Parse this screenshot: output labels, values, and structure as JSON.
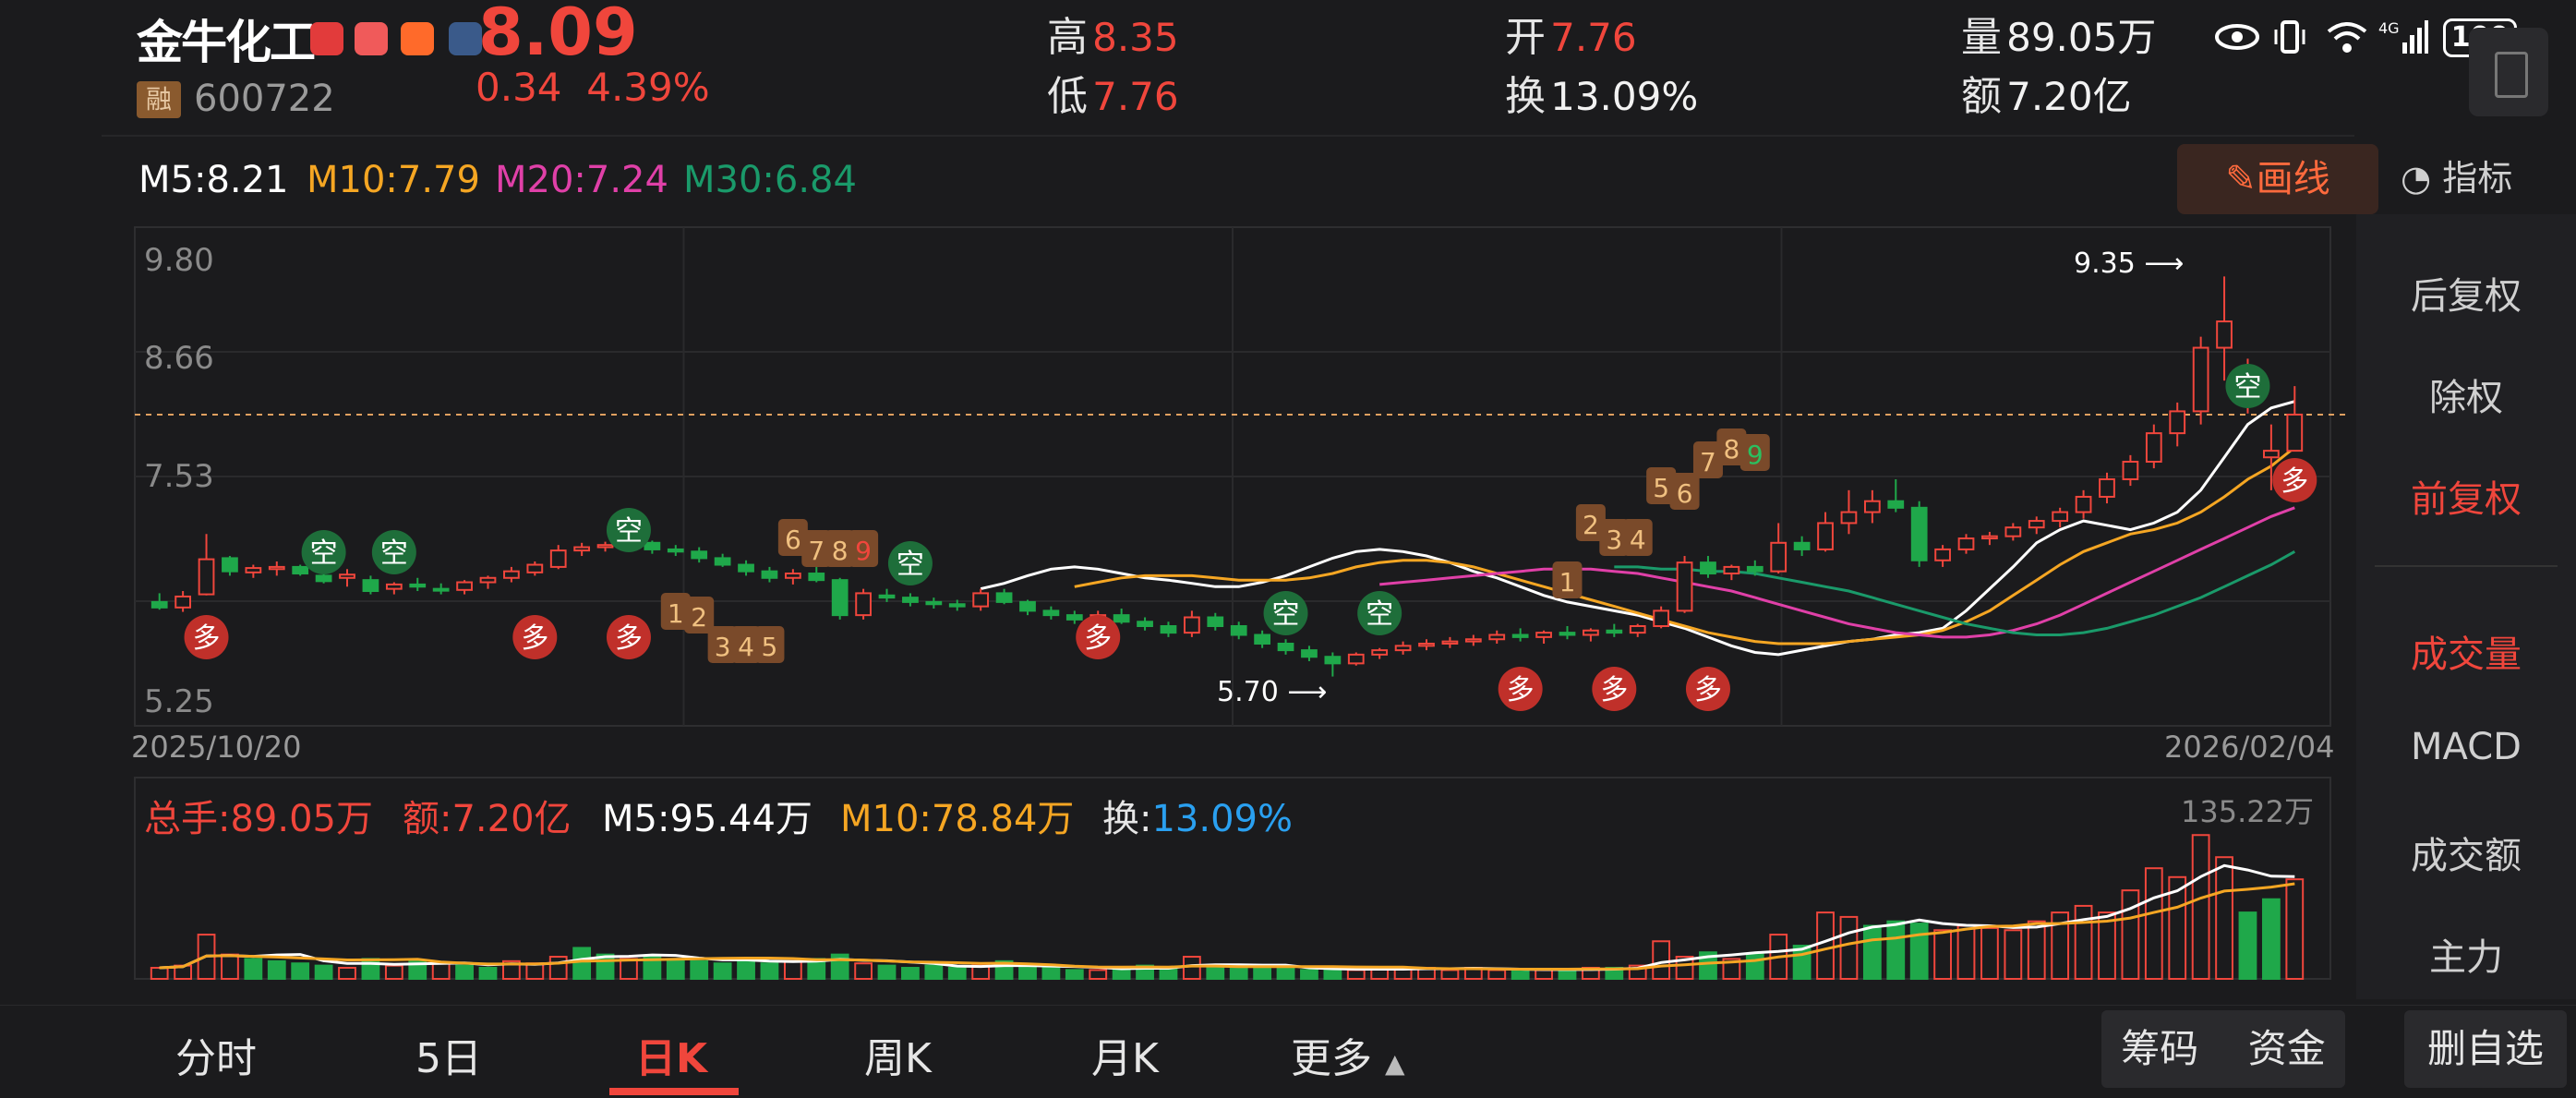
{
  "header": {
    "stock_name": "金牛化工",
    "price": "8.09",
    "change": "0.34",
    "change_pct": "4.39%",
    "margin_badge": "融",
    "code": "600722",
    "high_label": "高",
    "high": "8.35",
    "low_label": "低",
    "low": "7.76",
    "open_label": "开",
    "open": "7.76",
    "turnover_label": "换",
    "turnover": "13.09%",
    "volume_label": "量",
    "volume": "89.05万",
    "amount_label": "额",
    "amount": "7.20亿",
    "battery": "100"
  },
  "ma_legend": {
    "m5": "M5:8.21",
    "m10": "M10:7.79",
    "m20": "M20:7.24",
    "m30": "M30:6.84",
    "colors": {
      "m5": "#ffffff",
      "m10": "#f5a623",
      "m20": "#e040a8",
      "m30": "#1a9a6a"
    }
  },
  "draw_button": "画线",
  "indicator_button": "指标",
  "right_panel": {
    "items": [
      {
        "label": "后复权",
        "active": false
      },
      {
        "label": "除权",
        "active": false
      },
      {
        "label": "前复权",
        "active": true
      },
      {
        "label": "成交量",
        "active": true
      },
      {
        "label": "MACD",
        "active": false
      },
      {
        "label": "成交额",
        "active": false
      },
      {
        "label": "主力",
        "active": false
      }
    ]
  },
  "chart_data": [
    {
      "type": "candlestick",
      "y_ticks": [
        "9.80",
        "8.66",
        "7.53",
        "5.25"
      ],
      "ylim": [
        5.25,
        9.8
      ],
      "x_start_label": "2025/10/20",
      "x_end_label": "2026/02/04",
      "annotations": {
        "high": "9.35",
        "low": "5.70"
      },
      "candles": [
        [
          6.38,
          6.46,
          6.31,
          6.33
        ],
        [
          6.33,
          6.48,
          6.29,
          6.43
        ],
        [
          6.45,
          7.0,
          6.44,
          6.77
        ],
        [
          6.78,
          6.8,
          6.62,
          6.66
        ],
        [
          6.65,
          6.72,
          6.6,
          6.69
        ],
        [
          6.68,
          6.75,
          6.62,
          6.7
        ],
        [
          6.7,
          6.72,
          6.62,
          6.64
        ],
        [
          6.62,
          6.66,
          6.55,
          6.57
        ],
        [
          6.6,
          6.68,
          6.52,
          6.63
        ],
        [
          6.58,
          6.62,
          6.45,
          6.48
        ],
        [
          6.5,
          6.56,
          6.45,
          6.54
        ],
        [
          6.54,
          6.6,
          6.48,
          6.52
        ],
        [
          6.5,
          6.55,
          6.45,
          6.49
        ],
        [
          6.49,
          6.58,
          6.45,
          6.56
        ],
        [
          6.56,
          6.62,
          6.5,
          6.6
        ],
        [
          6.6,
          6.7,
          6.56,
          6.66
        ],
        [
          6.65,
          6.75,
          6.62,
          6.72
        ],
        [
          6.7,
          6.9,
          6.68,
          6.85
        ],
        [
          6.85,
          6.92,
          6.8,
          6.88
        ],
        [
          6.88,
          6.93,
          6.84,
          6.9
        ],
        [
          6.9,
          6.96,
          6.84,
          6.92
        ],
        [
          6.92,
          6.94,
          6.82,
          6.86
        ],
        [
          6.86,
          6.9,
          6.8,
          6.84
        ],
        [
          6.84,
          6.88,
          6.74,
          6.78
        ],
        [
          6.78,
          6.82,
          6.7,
          6.72
        ],
        [
          6.72,
          6.76,
          6.62,
          6.66
        ],
        [
          6.66,
          6.7,
          6.56,
          6.6
        ],
        [
          6.6,
          6.68,
          6.54,
          6.64
        ],
        [
          6.64,
          6.7,
          6.56,
          6.58
        ],
        [
          6.58,
          6.6,
          6.22,
          6.26
        ],
        [
          6.26,
          6.5,
          6.22,
          6.46
        ],
        [
          6.44,
          6.5,
          6.38,
          6.42
        ],
        [
          6.42,
          6.46,
          6.34,
          6.38
        ],
        [
          6.38,
          6.42,
          6.32,
          6.36
        ],
        [
          6.36,
          6.4,
          6.3,
          6.34
        ],
        [
          6.34,
          6.5,
          6.3,
          6.46
        ],
        [
          6.46,
          6.5,
          6.36,
          6.38
        ],
        [
          6.38,
          6.4,
          6.26,
          6.3
        ],
        [
          6.3,
          6.34,
          6.22,
          6.26
        ],
        [
          6.26,
          6.3,
          6.18,
          6.22
        ],
        [
          6.22,
          6.3,
          6.16,
          6.26
        ],
        [
          6.26,
          6.32,
          6.18,
          6.2
        ],
        [
          6.2,
          6.24,
          6.12,
          6.16
        ],
        [
          6.16,
          6.2,
          6.06,
          6.1
        ],
        [
          6.1,
          6.3,
          6.06,
          6.24
        ],
        [
          6.24,
          6.28,
          6.12,
          6.16
        ],
        [
          6.16,
          6.2,
          6.04,
          6.08
        ],
        [
          6.08,
          6.12,
          5.96,
          6.0
        ],
        [
          6.0,
          6.04,
          5.9,
          5.94
        ],
        [
          5.94,
          5.98,
          5.84,
          5.88
        ],
        [
          5.88,
          5.92,
          5.7,
          5.82
        ],
        [
          5.82,
          5.92,
          5.8,
          5.9
        ],
        [
          5.9,
          5.96,
          5.86,
          5.94
        ],
        [
          5.94,
          6.02,
          5.9,
          5.98
        ],
        [
          5.98,
          6.04,
          5.94,
          6.0
        ],
        [
          6.0,
          6.06,
          5.96,
          6.02
        ],
        [
          6.02,
          6.08,
          5.98,
          6.04
        ],
        [
          6.04,
          6.12,
          6.0,
          6.08
        ],
        [
          6.08,
          6.14,
          6.02,
          6.06
        ],
        [
          6.06,
          6.12,
          6.0,
          6.1
        ],
        [
          6.1,
          6.16,
          6.04,
          6.08
        ],
        [
          6.08,
          6.14,
          6.02,
          6.12
        ],
        [
          6.12,
          6.18,
          6.06,
          6.1
        ],
        [
          6.1,
          6.18,
          6.06,
          6.16
        ],
        [
          6.16,
          6.34,
          6.14,
          6.3
        ],
        [
          6.3,
          6.8,
          6.28,
          6.74
        ],
        [
          6.74,
          6.8,
          6.6,
          6.64
        ],
        [
          6.64,
          6.72,
          6.58,
          6.7
        ],
        [
          6.7,
          6.76,
          6.62,
          6.66
        ],
        [
          6.66,
          7.1,
          6.64,
          6.92
        ],
        [
          6.92,
          6.98,
          6.8,
          6.86
        ],
        [
          6.86,
          7.2,
          6.84,
          7.1
        ],
        [
          7.1,
          7.4,
          7.0,
          7.2
        ],
        [
          7.2,
          7.4,
          7.1,
          7.3
        ],
        [
          7.3,
          7.5,
          7.2,
          7.24
        ],
        [
          7.24,
          7.3,
          6.7,
          6.76
        ],
        [
          6.76,
          6.9,
          6.7,
          6.86
        ],
        [
          6.86,
          7.0,
          6.82,
          6.96
        ],
        [
          6.96,
          7.02,
          6.9,
          6.98
        ],
        [
          6.98,
          7.1,
          6.94,
          7.06
        ],
        [
          7.06,
          7.16,
          7.0,
          7.12
        ],
        [
          7.12,
          7.24,
          7.06,
          7.2
        ],
        [
          7.2,
          7.4,
          7.14,
          7.34
        ],
        [
          7.34,
          7.56,
          7.28,
          7.5
        ],
        [
          7.5,
          7.72,
          7.44,
          7.66
        ],
        [
          7.66,
          8.0,
          7.6,
          7.92
        ],
        [
          7.92,
          8.2,
          7.8,
          8.12
        ],
        [
          8.12,
          8.8,
          8.0,
          8.7
        ],
        [
          8.7,
          9.35,
          8.4,
          8.94
        ],
        [
          8.3,
          8.6,
          8.1,
          8.3
        ],
        [
          7.7,
          8.0,
          7.4,
          7.76
        ],
        [
          7.76,
          8.35,
          7.76,
          8.09
        ]
      ],
      "ma_series": {
        "m5": [
          6.5,
          6.55,
          6.62,
          6.68,
          6.7,
          6.68,
          6.64,
          6.6,
          6.58,
          6.55,
          6.52,
          6.52,
          6.56,
          6.62,
          6.7,
          6.78,
          6.84,
          6.86,
          6.84,
          6.8,
          6.74,
          6.66,
          6.6,
          6.52,
          6.44,
          6.38,
          6.34,
          6.3,
          6.26,
          6.2,
          6.14,
          6.06,
          5.98,
          5.92,
          5.9,
          5.94,
          5.98,
          6.02,
          6.04,
          6.08,
          6.1,
          6.14,
          6.3,
          6.5,
          6.7,
          6.92,
          7.04,
          7.12,
          7.08,
          7.04,
          7.1,
          7.2,
          7.4,
          7.7,
          8.0,
          8.15,
          8.21
        ],
        "m10": [
          6.52,
          6.56,
          6.6,
          6.62,
          6.62,
          6.62,
          6.6,
          6.58,
          6.58,
          6.58,
          6.6,
          6.64,
          6.7,
          6.74,
          6.76,
          6.76,
          6.74,
          6.7,
          6.64,
          6.58,
          6.52,
          6.46,
          6.4,
          6.34,
          6.28,
          6.22,
          6.16,
          6.1,
          6.06,
          6.02,
          6.0,
          6.0,
          6.0,
          6.02,
          6.04,
          6.06,
          6.08,
          6.12,
          6.2,
          6.3,
          6.44,
          6.58,
          6.72,
          6.84,
          6.92,
          7.0,
          7.04,
          7.1,
          7.2,
          7.34,
          7.5,
          7.62,
          7.79
        ],
        "m20": [
          6.54,
          6.56,
          6.58,
          6.6,
          6.62,
          6.64,
          6.66,
          6.68,
          6.68,
          6.68,
          6.66,
          6.64,
          6.6,
          6.56,
          6.52,
          6.48,
          6.42,
          6.36,
          6.3,
          6.24,
          6.18,
          6.14,
          6.1,
          6.08,
          6.06,
          6.06,
          6.08,
          6.12,
          6.18,
          6.26,
          6.36,
          6.46,
          6.56,
          6.66,
          6.76,
          6.86,
          6.96,
          7.06,
          7.16,
          7.24
        ],
        "m30": [
          6.7,
          6.7,
          6.68,
          6.68,
          6.66,
          6.66,
          6.64,
          6.6,
          6.56,
          6.52,
          6.48,
          6.42,
          6.36,
          6.3,
          6.24,
          6.18,
          6.14,
          6.1,
          6.08,
          6.08,
          6.1,
          6.14,
          6.2,
          6.26,
          6.34,
          6.42,
          6.52,
          6.62,
          6.72,
          6.84
        ]
      }
    },
    {
      "type": "bar",
      "name": "volume",
      "max_label": "135.22万",
      "legend": {
        "total": "总手:89.05万",
        "amount": "额:7.20亿",
        "m5": "M5:95.44万",
        "m10": "M10:78.84万",
        "turnover_label": "换:",
        "turnover": "13.09%"
      },
      "ylim": [
        0,
        135.22
      ],
      "values": [
        10,
        12,
        40,
        22,
        18,
        16,
        14,
        12,
        10,
        18,
        12,
        16,
        14,
        12,
        10,
        16,
        14,
        20,
        28,
        22,
        18,
        20,
        18,
        16,
        14,
        18,
        14,
        16,
        18,
        22,
        14,
        12,
        10,
        12,
        10,
        12,
        16,
        10,
        10,
        8,
        8,
        10,
        12,
        10,
        20,
        12,
        10,
        10,
        10,
        8,
        8,
        8,
        10,
        10,
        10,
        8,
        10,
        8,
        8,
        8,
        8,
        10,
        10,
        12,
        34,
        20,
        24,
        18,
        22,
        40,
        30,
        60,
        56,
        48,
        52,
        50,
        44,
        48,
        46,
        44,
        52,
        60,
        66,
        60,
        80,
        100,
        92,
        130,
        110,
        60,
        72,
        90
      ],
      "colors": [
        "r",
        "r",
        "r",
        "r",
        "g",
        "g",
        "g",
        "g",
        "r",
        "g",
        "r",
        "g",
        "r",
        "g",
        "g",
        "r",
        "r",
        "r",
        "g",
        "g",
        "r",
        "g",
        "g",
        "g",
        "g",
        "g",
        "g",
        "r",
        "g",
        "g",
        "r",
        "g",
        "g",
        "g",
        "g",
        "r",
        "g",
        "g",
        "g",
        "g",
        "r",
        "g",
        "g",
        "g",
        "r",
        "g",
        "g",
        "g",
        "g",
        "g",
        "g",
        "r",
        "r",
        "r",
        "r",
        "r",
        "r",
        "r",
        "g",
        "r",
        "g",
        "r",
        "g",
        "r",
        "r",
        "r",
        "g",
        "r",
        "g",
        "r",
        "g",
        "r",
        "r",
        "g",
        "g",
        "g",
        "r",
        "r",
        "r",
        "r",
        "r",
        "r",
        "r",
        "r",
        "r",
        "r",
        "r",
        "r",
        "r",
        "g",
        "g",
        "r"
      ]
    }
  ],
  "signals": {
    "short": "空",
    "long": "多",
    "counts": [
      "1",
      "2",
      "3",
      "4",
      "5",
      "6",
      "7",
      "8",
      "9"
    ]
  },
  "bottom_nav": {
    "tabs": [
      {
        "label": "分时",
        "active": false
      },
      {
        "label": "5日",
        "active": false
      },
      {
        "label": "日K",
        "active": true
      },
      {
        "label": "周K",
        "active": false
      },
      {
        "label": "月K",
        "active": false
      },
      {
        "label": "更多",
        "active": false
      }
    ],
    "buttons": [
      "筹码",
      "资金",
      "删自选"
    ]
  }
}
